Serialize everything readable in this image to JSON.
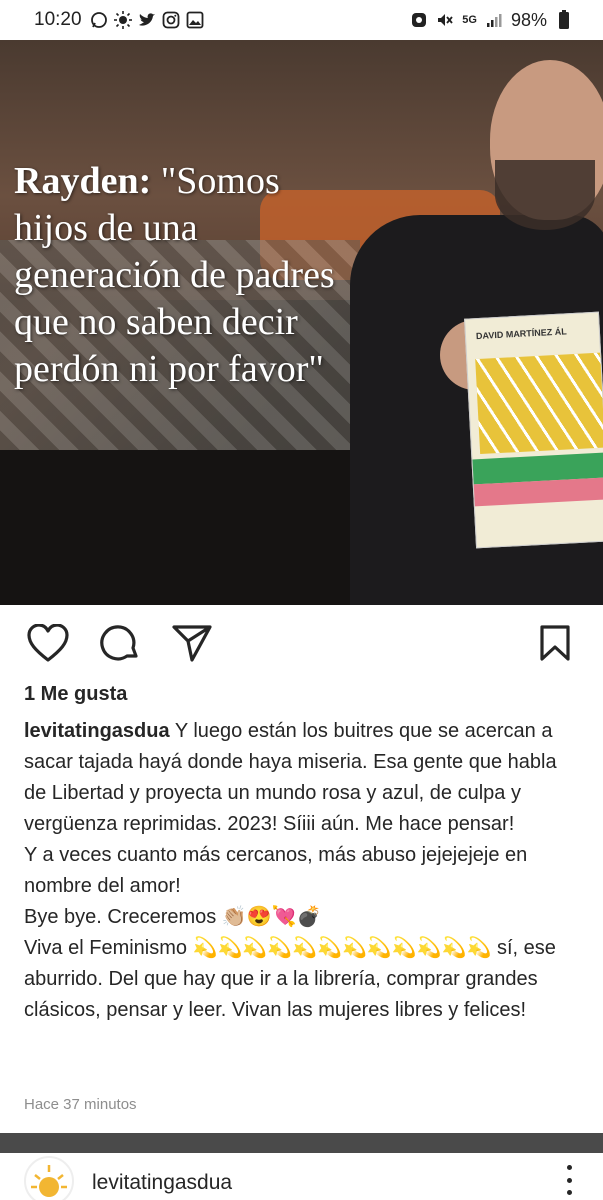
{
  "status_bar": {
    "time": "10:20",
    "network": "5G",
    "battery": "98%",
    "left_icons": [
      "whatsapp-icon",
      "brightness-icon",
      "twitter-icon",
      "instagram-icon",
      "gallery-icon"
    ],
    "right_icons": [
      "recycle-icon",
      "mute-icon",
      "network-5g-icon",
      "signal-icon",
      "battery-icon"
    ]
  },
  "post": {
    "image_text": {
      "name": "Rayden:",
      "quote": "\"Somos hijos de una generación de padres que no saben decir perdón ni por favor\""
    },
    "book_author": "DAVID MARTÍNEZ ÁL",
    "likes": "1 Me gusta",
    "username": "levitatingasdua",
    "caption_lines": [
      "Y luego están los buitres que se acercan a sacar tajada hayá donde haya miseria. Esa gente que habla de Libertad y proyecta un mundo rosa y azul, de culpa y vergüenza reprimidas. 2023! Síiii aún. Me hace pensar!",
      "Y a veces cuanto más cercanos, más abuso jejejejeje en nombre del amor!",
      "Bye bye. Creceremos 👏🏼😍💘💣",
      "Viva el Feminismo 💫💫💫💫💫💫💫💫💫💫💫💫 sí, ese aburrido. Del que hay que ir a la librería, comprar grandes clásicos, pensar y leer. Vivan las mujeres libres y felices!"
    ],
    "timestamp": "Hace 37 minutos"
  },
  "next_post": {
    "username": "levitatingasdua"
  },
  "colors": {
    "text": "#262626",
    "muted": "#8e8e8e"
  }
}
